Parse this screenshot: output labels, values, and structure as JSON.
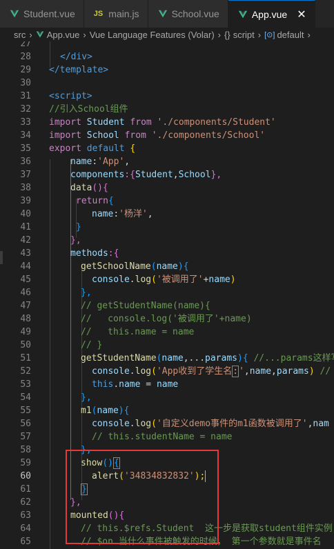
{
  "tabs": [
    {
      "label": "Student.vue",
      "icon": "vue-icon",
      "active": false
    },
    {
      "label": "main.js",
      "icon": "js-icon",
      "active": false
    },
    {
      "label": "School.vue",
      "icon": "vue-icon",
      "active": false
    },
    {
      "label": "App.vue",
      "icon": "vue-icon",
      "active": true
    }
  ],
  "breadcrumb": {
    "folder": "src",
    "file": "App.vue",
    "lang": "Vue Language Features (Volar)",
    "section": "script",
    "symbol": "default"
  },
  "line_numbers": [
    "27",
    "28",
    "29",
    "30",
    "31",
    "32",
    "33",
    "34",
    "35",
    "36",
    "37",
    "38",
    "39",
    "40",
    "41",
    "42",
    "43",
    "44",
    "45",
    "46",
    "47",
    "48",
    "49",
    "50",
    "51",
    "52",
    "53",
    "54",
    "55",
    "56",
    "57",
    "58",
    "59",
    "60",
    "61",
    "62",
    "63",
    "64",
    "65"
  ],
  "current_line": "60",
  "code": {
    "l27": "",
    "l28_close_div": "</div>",
    "l29_close_template": "</template>",
    "l31_script": "<script>",
    "l32_comment": "//引入School组件",
    "l33": [
      "import",
      " Student ",
      "from",
      " './components/Student'"
    ],
    "l34": [
      "import",
      " School ",
      "from",
      " './components/School'"
    ],
    "l35": [
      "export",
      " default ",
      "{"
    ],
    "l36": [
      "name",
      ":",
      "'App'",
      ","
    ],
    "l37": [
      "components",
      ":{",
      "Student",
      ",",
      "School",
      "},"
    ],
    "l38": [
      "data",
      "(){"
    ],
    "l39": [
      "return",
      "{"
    ],
    "l40": [
      "name",
      ":",
      "'杨洋'",
      ","
    ],
    "l41": "}",
    "l42": "},",
    "l43": [
      "methods",
      ":{"
    ],
    "l44": [
      "getSchoolName",
      "(",
      "name",
      "){"
    ],
    "l45": [
      "console",
      ".",
      "log",
      "(",
      "'被调用了'",
      "+",
      "name",
      ")"
    ],
    "l46": "},",
    "l47": "// getStudentName(name){",
    "l48": "//   console.log('被调用了'+name)",
    "l49": "//   this.name = name",
    "l50": "// }",
    "l51": [
      "getStudentName",
      "(",
      "name",
      ",...",
      "params",
      "){ ",
      "//...params这样写"
    ],
    "l52": [
      "console",
      ".",
      "log",
      "(",
      "'App收到了学生名",
      ":",
      "'",
      ",",
      "name",
      ",",
      "params",
      ") ",
      "//"
    ],
    "l53": [
      "this",
      ".",
      "name",
      " = ",
      "name"
    ],
    "l54": "},",
    "l55": [
      "m1",
      "(",
      "name",
      "){"
    ],
    "l56": [
      "console",
      ".",
      "log",
      "(",
      "'自定义demo事件的m1函数被调用了'",
      ",",
      "nam"
    ],
    "l57": "// this.studentName = name",
    "l58": "},",
    "l59": [
      "show",
      "()",
      "{"
    ],
    "l60": [
      "alert",
      "(",
      "'34834832832'",
      ");"
    ],
    "l61": "}",
    "l62": "},",
    "l63": [
      "mounted",
      "(){"
    ],
    "l64": "// this.$refs.Student  这一步是获取student组件实例",
    "l65": "// $on 当什么事件被触发的时候， 第一个参数就是事件名"
  }
}
